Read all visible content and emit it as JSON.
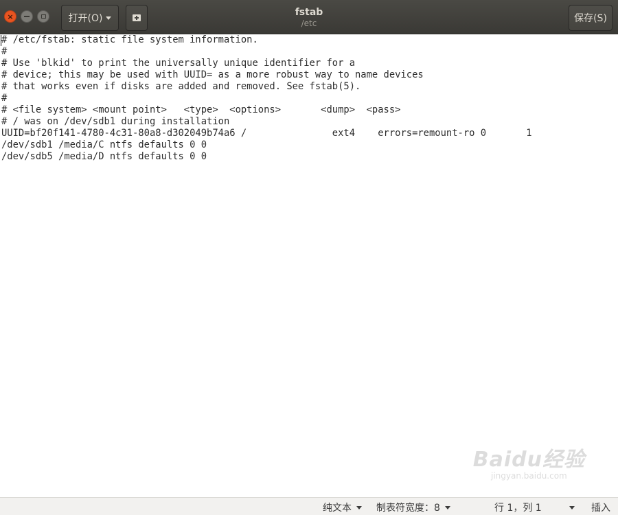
{
  "window": {
    "title": "fstab",
    "subtitle": "/etc"
  },
  "header": {
    "open_label": "打开(O)",
    "save_label": "保存(S)"
  },
  "editor": {
    "lines": [
      "# /etc/fstab: static file system information.",
      "#",
      "# Use 'blkid' to print the universally unique identifier for a",
      "# device; this may be used with UUID= as a more robust way to name devices",
      "# that works even if disks are added and removed. See fstab(5).",
      "#",
      "# <file system> <mount point>   <type>  <options>       <dump>  <pass>",
      "# / was on /dev/sdb1 during installation",
      "UUID=bf20f141-4780-4c31-80a8-d302049b74a6 /               ext4    errors=remount-ro 0       1",
      "/dev/sdb1 /media/C ntfs defaults 0 0",
      "/dev/sdb5 /media/D ntfs defaults 0 0"
    ]
  },
  "statusbar": {
    "language": "纯文本",
    "tab_width": "制表符宽度：8",
    "position": "行 1，列 1",
    "insert_mode": "插入"
  },
  "watermark": {
    "logo": "Baidu经验",
    "url": "jingyan.baidu.com"
  },
  "colors": {
    "close_button": "#e95420",
    "titlebar": "#3f3e39"
  }
}
